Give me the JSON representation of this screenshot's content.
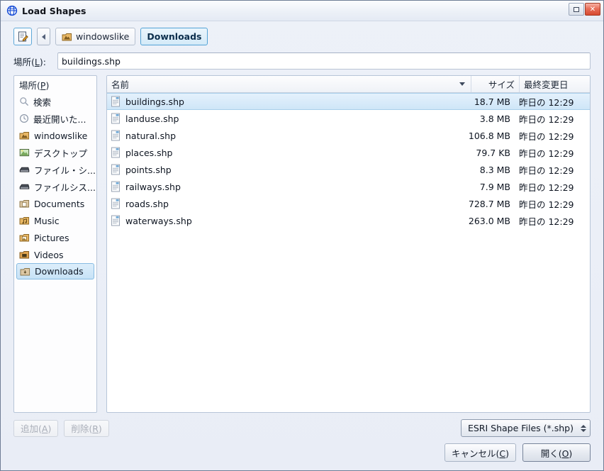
{
  "window": {
    "title": "Load Shapes",
    "icon": "globe-icon",
    "controls": {
      "maximize": "maximize-icon",
      "close": "close-icon"
    }
  },
  "toolbar": {
    "edit_location_button": "edit-location-icon",
    "back_button": "back-arrow-icon",
    "breadcrumbs": [
      {
        "label": "windowslike",
        "icon": "home-folder-icon",
        "active": false
      },
      {
        "label": "Downloads",
        "icon": "",
        "active": true
      }
    ]
  },
  "location": {
    "label": "場所(L):",
    "value": "buildings.shp",
    "placeholder": ""
  },
  "sidebar": {
    "header": "場所(P)",
    "items": [
      {
        "label": "検索",
        "icon": "search-icon",
        "selected": false
      },
      {
        "label": "最近開いた...",
        "icon": "recent-clock-icon",
        "selected": false
      },
      {
        "label": "windowslike",
        "icon": "home-folder-icon",
        "selected": false
      },
      {
        "label": "デスクトップ",
        "icon": "desktop-icon",
        "selected": false
      },
      {
        "label": "ファイル・シ...",
        "icon": "drive-icon",
        "selected": false
      },
      {
        "label": "ファイルシス...",
        "icon": "drive-icon",
        "selected": false
      },
      {
        "label": "Documents",
        "icon": "folder-icon",
        "selected": false
      },
      {
        "label": "Music",
        "icon": "folder-icon",
        "selected": false
      },
      {
        "label": "Pictures",
        "icon": "folder-icon",
        "selected": false
      },
      {
        "label": "Videos",
        "icon": "folder-icon",
        "selected": false
      },
      {
        "label": "Downloads",
        "icon": "folder-icon",
        "selected": true
      }
    ]
  },
  "filelist": {
    "columns": {
      "name": "名前",
      "size": "サイズ",
      "modified": "最終変更日"
    },
    "sort": {
      "column": "名前",
      "direction": "desc"
    },
    "rows": [
      {
        "name": "buildings.shp",
        "size": "18.7 MB",
        "modified": "昨日の 12:29",
        "selected": true
      },
      {
        "name": "landuse.shp",
        "size": "3.8 MB",
        "modified": "昨日の 12:29",
        "selected": false
      },
      {
        "name": "natural.shp",
        "size": "106.8 MB",
        "modified": "昨日の 12:29",
        "selected": false
      },
      {
        "name": "places.shp",
        "size": "79.7 KB",
        "modified": "昨日の 12:29",
        "selected": false
      },
      {
        "name": "points.shp",
        "size": "8.3 MB",
        "modified": "昨日の 12:29",
        "selected": false
      },
      {
        "name": "railways.shp",
        "size": "7.9 MB",
        "modified": "昨日の 12:29",
        "selected": false
      },
      {
        "name": "roads.shp",
        "size": "728.7 MB",
        "modified": "昨日の 12:29",
        "selected": false
      },
      {
        "name": "waterways.shp",
        "size": "263.0 MB",
        "modified": "昨日の 12:29",
        "selected": false
      }
    ]
  },
  "footer": {
    "add_button": "追加(A)",
    "remove_button": "削除(R)",
    "filter_value": "ESRI Shape Files (*.shp)",
    "cancel_button": "キャンセル(C)",
    "open_button": "開く(O)"
  },
  "colors": {
    "accent": "#53a3d6",
    "selection": "#cfe6f8",
    "window_bg": "#edf1f8",
    "close_button": "#d6492f"
  }
}
